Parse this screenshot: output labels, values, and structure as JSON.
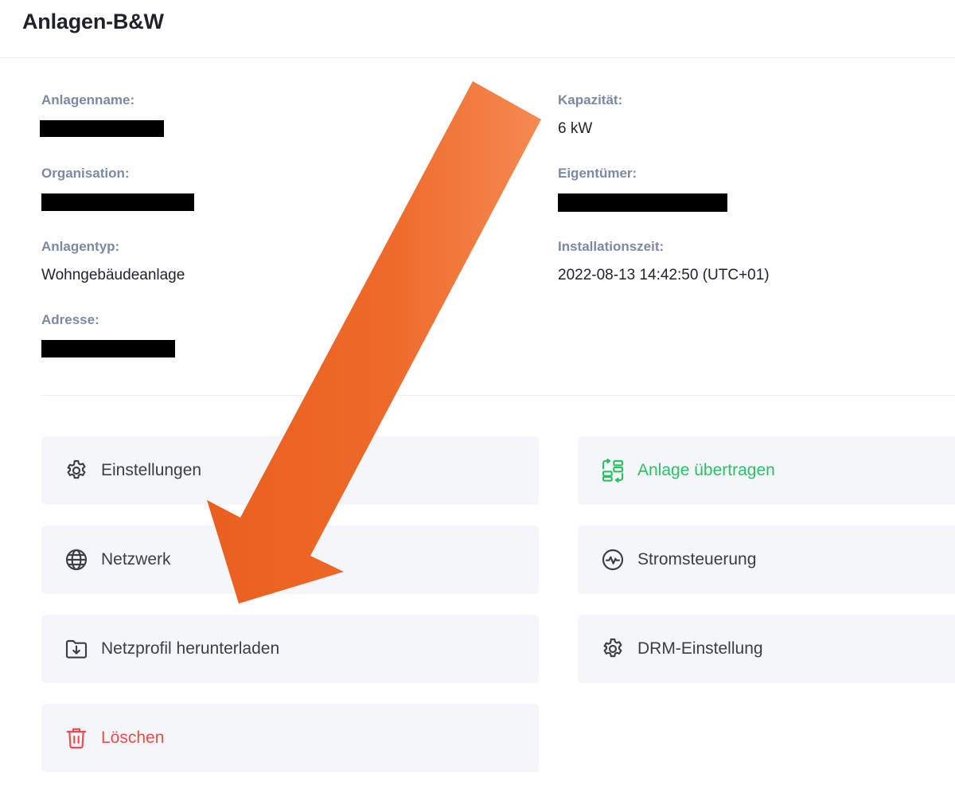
{
  "header": {
    "title": "Anlagen-B&W"
  },
  "info": {
    "plant_name_label": "Anlagenname:",
    "organisation_label": "Organisation:",
    "plant_type_label": "Anlagentyp:",
    "plant_type_value": "Wohngebäudeanlage",
    "address_label": "Adresse:",
    "capacity_label": "Kapazität:",
    "capacity_value": "6 kW",
    "owner_label": "Eigentümer:",
    "install_time_label": "Installationszeit:",
    "install_time_value": "2022-08-13 14:42:50 (UTC+01)"
  },
  "actions": {
    "settings": "Einstellungen",
    "transfer": "Anlage übertragen",
    "network": "Netzwerk",
    "power_control": "Stromsteuerung",
    "download_profile": "Netzprofil herunterladen",
    "drm_setting": "DRM-Einstellung",
    "delete": "Löschen"
  },
  "colors": {
    "accent_green": "#2fbf66",
    "danger_red": "#f04a4a",
    "arrow_orange": "#ee6a2a",
    "label_gray": "#7b8aa1"
  },
  "icons": {
    "settings": "gear-icon",
    "transfer": "transfer-icon",
    "network": "globe-icon",
    "power_control": "pulse-icon",
    "download_profile": "folder-download-icon",
    "drm_setting": "gear-icon",
    "delete": "trash-icon"
  }
}
